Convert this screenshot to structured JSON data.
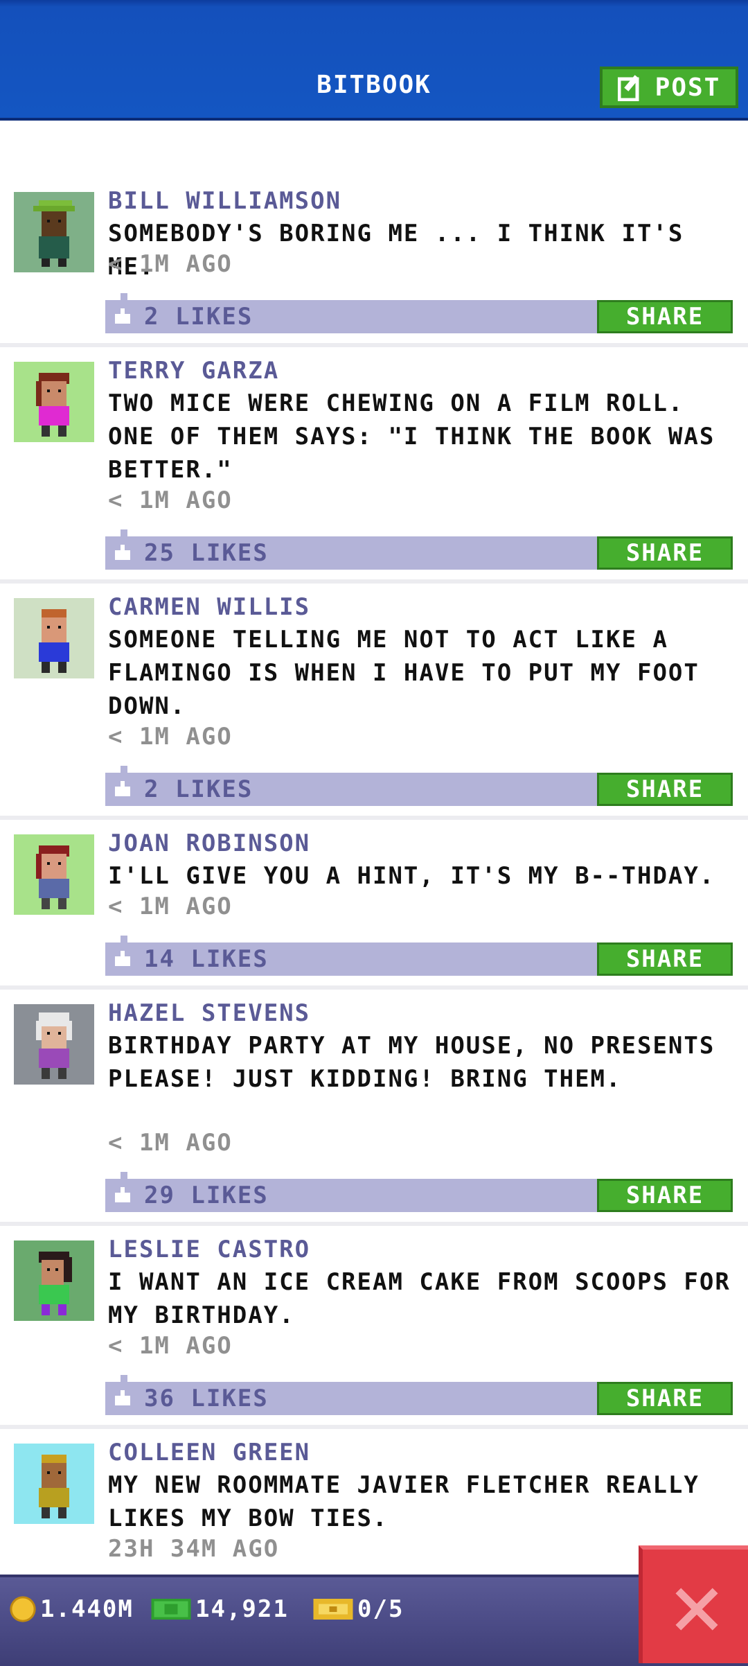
{
  "header": {
    "title": "BITBOOK",
    "post_label": "POST"
  },
  "posts": [
    {
      "name": "BILL WILLIAMSON",
      "text": "SOMEBODY'S BORING ME ... I THINK IT'S ME.",
      "time": "< 1M AGO",
      "likes": "2 LIKES",
      "share": "SHARE"
    },
    {
      "name": "TERRY GARZA",
      "text": "TWO MICE WERE CHEWING ON A FILM ROLL. ONE OF THEM SAYS: \"I THINK THE BOOK WAS BETTER.\"",
      "time": "< 1M AGO",
      "likes": "25 LIKES",
      "share": "SHARE"
    },
    {
      "name": "CARMEN WILLIS",
      "text": "SOMEONE TELLING ME NOT TO ACT LIKE A FLAMINGO IS WHEN I HAVE TO PUT MY FOOT DOWN.",
      "time": "< 1M AGO",
      "likes": "2 LIKES",
      "share": "SHARE"
    },
    {
      "name": "JOAN ROBINSON",
      "text": "I'LL GIVE YOU A HINT, IT'S MY B--THDAY.",
      "time": "< 1M AGO",
      "likes": "14 LIKES",
      "share": "SHARE"
    },
    {
      "name": "HAZEL STEVENS",
      "text": "BIRTHDAY PARTY AT MY HOUSE, NO PRESENTS PLEASE! JUST KIDDING! BRING THEM.",
      "time": "< 1M AGO",
      "likes": "29 LIKES",
      "share": "SHARE"
    },
    {
      "name": "LESLIE CASTRO",
      "text": "I WANT AN ICE CREAM CAKE FROM SCOOPS FOR MY BIRTHDAY.",
      "time": "< 1M AGO",
      "likes": "36 LIKES",
      "share": "SHARE"
    },
    {
      "name": "COLLEEN GREEN",
      "text": "MY NEW ROOMMATE JAVIER FLETCHER REALLY LIKES MY BOW TIES.",
      "time": "23H 34M AGO"
    }
  ],
  "status": {
    "coins": "1.440M",
    "bux": "14,921",
    "tickets": "0/5"
  },
  "colors": {
    "header_blue": "#1456c2",
    "share_green": "#46ae2e",
    "like_bar": "#b3b3d8",
    "close_red": "#e23b45"
  },
  "icons": {
    "post": "edit-icon",
    "like": "thumbs-up-icon",
    "coin": "coin-icon",
    "bux": "cash-icon",
    "ticket": "ticket-icon",
    "close": "close-icon"
  }
}
